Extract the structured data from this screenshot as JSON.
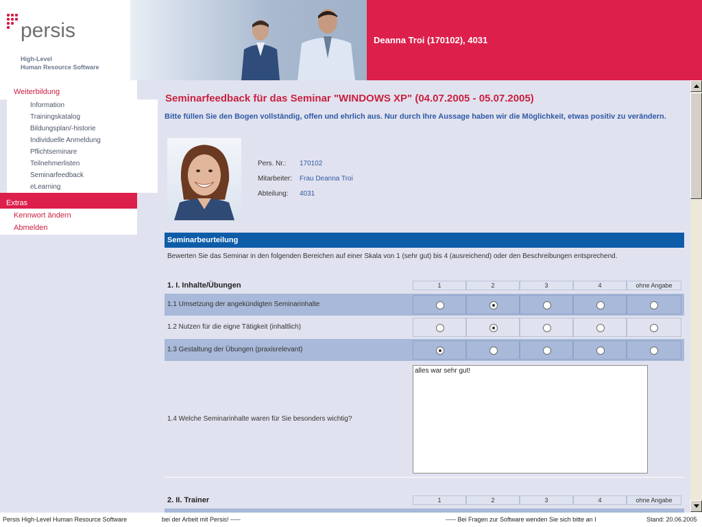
{
  "header": {
    "logo_text": "persis",
    "logo_sub_line1": "High-Level",
    "logo_sub_line2": "Human Resource Software",
    "user_display": "Deanna Troi (170102), 4031",
    "brand_color": "#dc1f4b"
  },
  "nav": {
    "section_title": "Weiterbildung",
    "items": [
      {
        "label": "Information"
      },
      {
        "label": "Trainingskatalog"
      },
      {
        "label": "Bildungsplan/-historie"
      },
      {
        "label": "Individuelle Anmeldung"
      },
      {
        "label": "Pflichtseminare"
      },
      {
        "label": "Teilnehmerlisten"
      },
      {
        "label": "Seminarfeedback"
      },
      {
        "label": "eLearning"
      }
    ],
    "extras_label": "Extras",
    "change_password": "Kennwort ändern",
    "logout": "Abmelden"
  },
  "main": {
    "title": "Seminarfeedback für das Seminar  \"WINDOWS XP\" (04.07.2005 - 05.07.2005)",
    "intro": "Bitte füllen Sie den Bogen vollständig, offen und ehrlich aus. Nur durch Ihre Aussage haben wir die Möglichkeit, etwas positiv zu verändern.",
    "info": {
      "persnr_label": "Pers. Nr.:",
      "persnr_value": "170102",
      "employee_label": "Mitarbeiter:",
      "employee_value": "Frau Deanna Troi",
      "department_label": "Abteilung:",
      "department_value": "4031"
    },
    "section_title": "Seminarbeurteilung",
    "scale_note": "Bewerten Sie das Seminar in den folgenden Bereichen auf einer Skala von 1 (sehr gut) bis 4 (ausreichend) oder den Beschreibungen entsprechend.",
    "scale_columns": [
      "1",
      "2",
      "3",
      "4",
      "ohne Angabe"
    ],
    "group1_title": "1. I. Inhalte/Übungen",
    "questions": [
      {
        "label": "1.1  Umsetzung der angekündigten Seminarinhalte",
        "selected": 2
      },
      {
        "label": "1.2  Nutzen für die eigne Tätigkeit (inhaltlich)",
        "selected": 2
      },
      {
        "label": "1.3  Gestaltung der Übungen (praxisrelevant)",
        "selected": 1
      }
    ],
    "free_question": "1.4  Welche Seminarinhalte waren für Sie besonders wichtig?",
    "free_answer": "alles war sehr gut!",
    "group2_title": "2. II. Trainer"
  },
  "footer": {
    "left": "Persis High-Level Human Resource Software",
    "ticker1": "bei der Arbeit mit Persis! -----",
    "ticker2": "----- Bei Fragen zur Software wenden Sie sich bitte an I",
    "stand": "Stand: 20.06.2005"
  }
}
